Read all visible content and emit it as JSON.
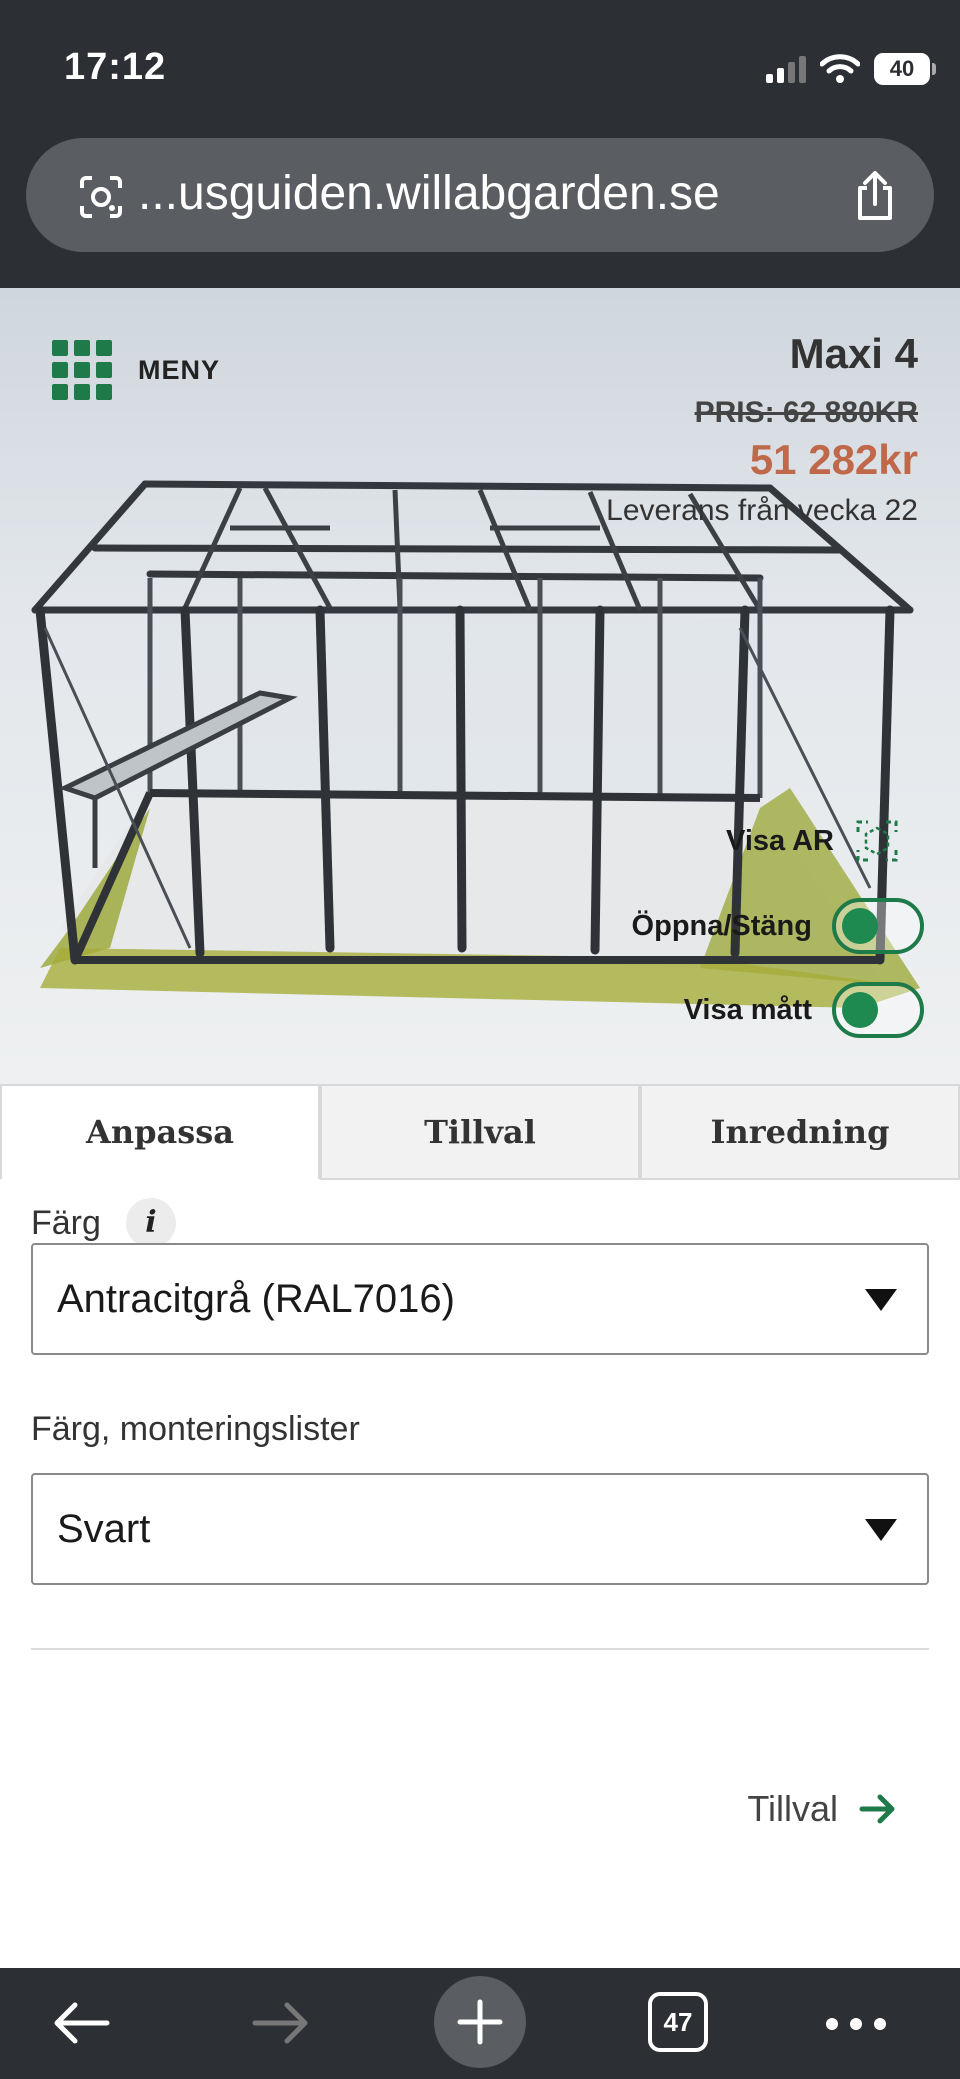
{
  "status_bar": {
    "time": "17:12",
    "battery": "40"
  },
  "browser": {
    "url": "...usguiden.willabgarden.se",
    "tab_count": "47"
  },
  "viewer": {
    "menu_label": "MENY",
    "product_name": "Maxi 4",
    "old_price": "PRIS: 62 880KR",
    "new_price": "51 282kr",
    "delivery": "Leverans från vecka 22",
    "ar_label": "Visa AR",
    "open_close_label": "Öppna/Stäng",
    "open_close_on": false,
    "show_measure_label": "Visa mått",
    "show_measure_on": false
  },
  "tabs": [
    {
      "label": "Anpassa",
      "active": true
    },
    {
      "label": "Tillval",
      "active": false
    },
    {
      "label": "Inredning",
      "active": false
    }
  ],
  "form": {
    "color_label": "Färg",
    "color_info": "i",
    "color_value": "Antracitgrå (RAL7016)",
    "strip_label": "Färg, monteringslister",
    "strip_value": "Svart"
  },
  "next": {
    "label": "Tillval"
  },
  "colors": {
    "brand_green": "#1e7a48",
    "sale_price": "#c0684a",
    "chrome": "#2c2f33"
  },
  "icons": [
    "signal-icon",
    "wifi-icon",
    "battery-icon",
    "camera-search-icon",
    "share-icon",
    "grid-menu-icon",
    "ar-scan-icon",
    "info-icon",
    "caret-down-icon",
    "arrow-right-icon",
    "back-icon",
    "forward-icon",
    "plus-icon",
    "tabs-icon",
    "more-icon"
  ]
}
